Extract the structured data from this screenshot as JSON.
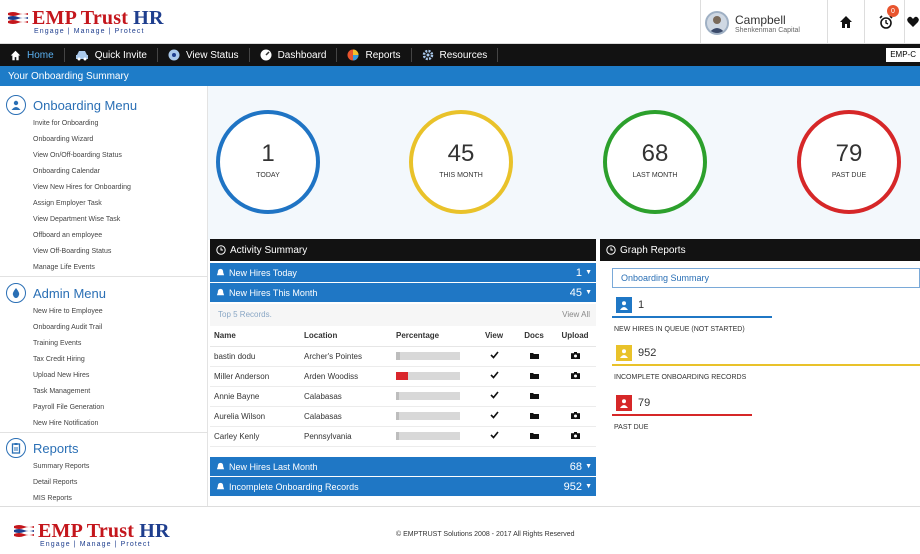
{
  "brand": {
    "name_main": "EMP Trust",
    "name_hr": "HR",
    "tagline": "Engage | Manage | Protect"
  },
  "user": {
    "name": "Campbell",
    "company": "Shenkenman Capital"
  },
  "header": {
    "notification_count": "0"
  },
  "nav": {
    "items": [
      {
        "label": "Home",
        "icon": "home-icon",
        "active": true
      },
      {
        "label": "Quick Invite",
        "icon": "car-icon"
      },
      {
        "label": "View Status",
        "icon": "eye-icon"
      },
      {
        "label": "Dashboard",
        "icon": "dashboard-icon"
      },
      {
        "label": "Reports",
        "icon": "pie-chart-icon"
      },
      {
        "label": "Resources",
        "icon": "gear-icon"
      }
    ],
    "emp_label": "EMP-C"
  },
  "summary_bar": {
    "title": "Your Onboarding Summary"
  },
  "sidebar": {
    "onboarding": {
      "title": "Onboarding Menu",
      "items": [
        "Invite for Onboarding",
        "Onboarding Wizard",
        "View On/Off-boarding Status",
        "Onboarding Calendar",
        "View New Hires for Onboarding",
        "Assign Employer Task",
        "View Department Wise Task",
        "Offboard an employee",
        "View Off-Boarding Status",
        "Manage Life Events"
      ]
    },
    "admin": {
      "title": "Admin Menu",
      "items": [
        "New Hire to Employee",
        "Onboarding Audit Trail",
        "Training Events",
        "Tax Credit Hiring",
        "Upload New Hires",
        "Task Management",
        "Payroll File Generation",
        "New Hire Notification"
      ]
    },
    "reports": {
      "title": "Reports",
      "items": [
        "Summary Reports",
        "Detail Reports",
        "MIS Reports"
      ]
    }
  },
  "stats": [
    {
      "value": "1",
      "label": "TODAY",
      "color": "#1f74c4"
    },
    {
      "value": "45",
      "label": "THIS MONTH",
      "color": "#e9c22a"
    },
    {
      "value": "68",
      "label": "LAST MONTH",
      "color": "#2ca02c"
    },
    {
      "value": "79",
      "label": "PAST DUE",
      "color": "#d62728"
    }
  ],
  "activity": {
    "title": "Activity Summary",
    "rows": {
      "today": {
        "label": "New Hires Today",
        "count": "1"
      },
      "this_month": {
        "label": "New Hires This Month",
        "count": "45"
      },
      "last_month": {
        "label": "New Hires Last Month",
        "count": "68"
      },
      "incomplete": {
        "label": "Incomplete Onboarding Records",
        "count": "952"
      }
    },
    "records_title": "Top 5 Records.",
    "view_all": "View All",
    "columns": [
      "Name",
      "Location",
      "Percentage",
      "View",
      "Docs",
      "Upload"
    ],
    "records": [
      {
        "name": "bastin dodu",
        "location": "Archer's Pointes",
        "percent": 0.06,
        "upload": true
      },
      {
        "name": "Miller Anderson",
        "location": "Arden Woodiss",
        "percent": 0.18,
        "upload": true
      },
      {
        "name": "Annie Bayne",
        "location": "Calabasas",
        "percent": 0.05,
        "upload": false
      },
      {
        "name": "Aurelia Wilson",
        "location": "Calabasas",
        "percent": 0.05,
        "upload": true
      },
      {
        "name": "Carley Kenly",
        "location": "Pennsylvania",
        "percent": 0.05,
        "upload": true
      }
    ]
  },
  "graph": {
    "title": "Graph Reports",
    "select": "Onboarding Summary",
    "items": [
      {
        "value": "1",
        "label": "NEW HIRES IN QUEUE (NOT STARTED)",
        "color": "#1f77c5"
      },
      {
        "value": "952",
        "label": "INCOMPLETE ONBOARDING RECORDS",
        "color": "#e9c22a"
      },
      {
        "value": "79",
        "label": "PAST DUE",
        "color": "#d62728"
      }
    ]
  },
  "footer": {
    "copyright": "© EMPTRUST Solutions 2008 - 2017 All Rights Reserved"
  }
}
